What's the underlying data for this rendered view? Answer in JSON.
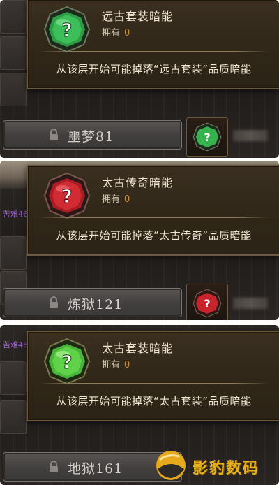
{
  "panels": [
    {
      "id": "ancient-set",
      "tooltip_title": "远古套装暗能",
      "own_label": "拥有",
      "own_count": "0",
      "description": "从该层开始可能掉落“远古套装”品质暗能",
      "floor_label": "噩梦81",
      "gem_color": "green"
    },
    {
      "id": "primal-legendary",
      "tooltip_title": "太古传奇暗能",
      "own_label": "拥有",
      "own_count": "0",
      "description": "从该层开始可能掉落“太古传奇”品质暗能",
      "floor_label": "炼狱121",
      "gem_color": "red",
      "background_text": "苦难46 "
    },
    {
      "id": "primal-set",
      "tooltip_title": "太古套装暗能",
      "own_label": "拥有",
      "own_count": "0",
      "description": "从该层开始可能掉落“太古套装”品质暗能",
      "floor_label": "地狱161",
      "gem_color": "green",
      "background_text": "苦难46"
    }
  ],
  "watermark": {
    "text": "影豹数码"
  },
  "colors": {
    "green_gem": "#2fb04a",
    "red_gem": "#c8242b",
    "gold_border": "#6b5a3d",
    "own_count": "#cf8a3a"
  },
  "icons": [
    "green-question-gem-icon",
    "red-question-gem-icon",
    "lock-icon"
  ]
}
